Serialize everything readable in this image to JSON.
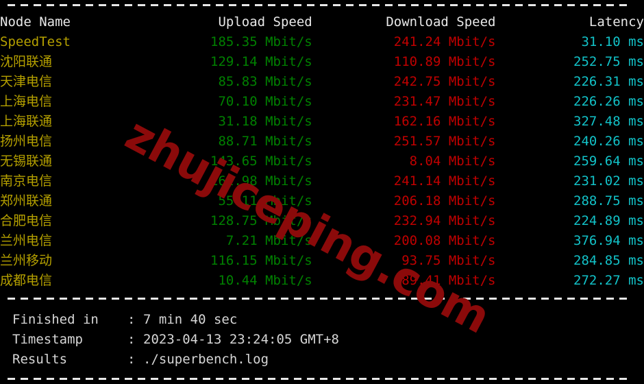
{
  "terminal": {
    "background_color": "#000000",
    "separator_color": "#e8e8e8"
  },
  "colors": {
    "header": "#e8e8e8",
    "node": "#b5a000",
    "upload": "#008000",
    "download": "#c00000",
    "latency": "#12c2c8",
    "footer": "#d6d6d6",
    "watermark": "#8b0a0a"
  },
  "table": {
    "headers": {
      "node": "Node Name",
      "upload": "Upload Speed",
      "download": "Download Speed",
      "latency": "Latency"
    },
    "rows": [
      {
        "node": "SpeedTest",
        "upload": "185.35 Mbit/s",
        "download": "241.24 Mbit/s",
        "latency": "31.10 ms"
      },
      {
        "node": "沈阳联通",
        "upload": "129.14 Mbit/s",
        "download": "110.89 Mbit/s",
        "latency": "252.75 ms"
      },
      {
        "node": "天津电信",
        "upload": "85.83 Mbit/s",
        "download": "242.75 Mbit/s",
        "latency": "226.31 ms"
      },
      {
        "node": "上海电信",
        "upload": "70.10 Mbit/s",
        "download": "231.47 Mbit/s",
        "latency": "226.26 ms"
      },
      {
        "node": "上海联通",
        "upload": "31.18 Mbit/s",
        "download": "162.16 Mbit/s",
        "latency": "327.48 ms"
      },
      {
        "node": "扬州电信",
        "upload": "88.71 Mbit/s",
        "download": "251.57 Mbit/s",
        "latency": "240.26 ms"
      },
      {
        "node": "无锡联通",
        "upload": "143.65 Mbit/s",
        "download": "8.04 Mbit/s",
        "latency": "259.64 ms"
      },
      {
        "node": "南京电信",
        "upload": "162.98 Mbit/s",
        "download": "241.14 Mbit/s",
        "latency": "231.02 ms"
      },
      {
        "node": "郑州联通",
        "upload": "55.11 Mbit/s",
        "download": "206.18 Mbit/s",
        "latency": "288.75 ms"
      },
      {
        "node": "合肥电信",
        "upload": "128.75 Mbit/s",
        "download": "232.94 Mbit/s",
        "latency": "224.89 ms"
      },
      {
        "node": "兰州电信",
        "upload": "7.21 Mbit/s",
        "download": "200.08 Mbit/s",
        "latency": "376.94 ms"
      },
      {
        "node": "兰州移动",
        "upload": "116.15 Mbit/s",
        "download": "93.75 Mbit/s",
        "latency": "284.85 ms"
      },
      {
        "node": "成都电信",
        "upload": "10.44 Mbit/s",
        "download": "189.41 Mbit/s",
        "latency": "272.27 ms"
      }
    ]
  },
  "footer": {
    "colon": ":",
    "lines": [
      {
        "label": "Finished in",
        "value": "7 min 40 sec"
      },
      {
        "label": "Timestamp",
        "value": "2023-04-13 23:24:05 GMT+8"
      },
      {
        "label": "Results",
        "value": "./superbench.log"
      }
    ]
  },
  "watermark": {
    "text": "zhujiceping.com"
  }
}
